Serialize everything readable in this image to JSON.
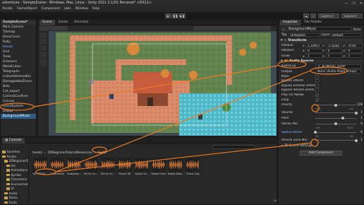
{
  "window": {
    "title": "adventure - SampleScene - Windows, Mac, Linux - Unity 2021.3.12f1 Personal* <DX11>",
    "controls": [
      "—",
      "☐",
      "✕"
    ]
  },
  "menu": [
    "Assets",
    "GameObject",
    "Component",
    "Jobs",
    "Window",
    "Help"
  ],
  "toolbar": {
    "play_icon": "▶",
    "pause_icon": "❚❚",
    "step_icon": "▶❚",
    "cloud_icon": "☁",
    "search_icon": "⌕",
    "layers_label": "Layers",
    "layout_label": "Layout"
  },
  "hierarchy": {
    "scene": "SampleScene*",
    "items": [
      {
        "label": "Main Camera",
        "kind": "normal"
      },
      {
        "label": "Tilemap",
        "kind": "normal"
      },
      {
        "label": "DoenCover",
        "kind": "normal"
      },
      {
        "label": "Ruby",
        "kind": "normal"
      },
      {
        "label": "House",
        "kind": "blue"
      },
      {
        "label": "Grid",
        "kind": "normal"
      },
      {
        "label": "Trees",
        "kind": "normal"
      },
      {
        "label": "Greeners",
        "kind": "normal"
      },
      {
        "label": "MetalCubes",
        "kind": "normal"
      },
      {
        "label": "Telegraphs",
        "kind": "normal"
      },
      {
        "label": "CollectibleHealths",
        "kind": "normal"
      },
      {
        "label": "DamageableZones",
        "kind": "normal"
      },
      {
        "label": "Bots",
        "kind": "normal"
      },
      {
        "label": "Cat_expert",
        "kind": "normal"
      },
      {
        "label": "CameraConfiner",
        "kind": "normal"
      },
      {
        "label": "Canvas",
        "kind": "normal"
      },
      {
        "label": "EventSystem",
        "kind": "normal"
      },
      {
        "label": "Global",
        "kind": "normal"
      },
      {
        "label": "BackgroundMusic",
        "kind": "selected"
      }
    ]
  },
  "scene_view": {
    "tabs": [
      "Scene",
      "Game",
      "Animator"
    ]
  },
  "inspector": {
    "tabs": [
      "Inspector",
      "Tile Palette"
    ],
    "object_name": "BackgroundMusic",
    "static_label": "Static",
    "tag_label": "Tag",
    "tag_value": "Untagged",
    "layer_label": "Layer",
    "layer_value": "Default",
    "transform": {
      "title": "Transform",
      "rows": [
        {
          "label": "Position",
          "x": "1.10957",
          "y": "-1.6282",
          "z": "-0.00"
        },
        {
          "label": "Rotation",
          "x": "0",
          "y": "0",
          "z": "0"
        },
        {
          "label": "Scale",
          "x": "1",
          "y": "1",
          "z": "1"
        }
      ]
    },
    "audio_source": {
      "title": "Audio Source",
      "audioclip_label": "AudioClip",
      "audioclip_value": "♫ 3D MUSIC LOOP",
      "output_label": "Output",
      "output_value": "None (Audio Mixer Group)",
      "toggles": [
        {
          "label": "Mute",
          "checked": false
        },
        {
          "label": "Bypass Effects",
          "checked": false
        },
        {
          "label": "Bypass Listener Effects",
          "checked": false
        },
        {
          "label": "Bypass Reverb Zones",
          "checked": false
        },
        {
          "label": "Play On Awake",
          "checked": true
        },
        {
          "label": "Loop",
          "checked": true
        }
      ],
      "priority_label": "Priority",
      "priority_value": "128",
      "priority_fraction": 0.5,
      "priority_left": "High",
      "priority_right": "Low",
      "volume_label": "Volume",
      "volume_value": "1",
      "volume_fraction": 1.0,
      "pitch_label": "Pitch",
      "pitch_value": "1",
      "pitch_fraction": 0.67,
      "stereo_label": "Stereo Pan",
      "stereo_value": "0",
      "stereo_fraction": 0.5,
      "stereo_left": "Left",
      "stereo_right": "Right",
      "spatial_label": "Spatial Blend",
      "spatial_value": "0",
      "spatial_fraction": 0.0,
      "spatial_left": "2D",
      "spatial_right": "3D",
      "reverb_label": "Reverb Zone Mix",
      "reverb_value": "1",
      "reverb_fraction": 1.0
    },
    "sound_settings": "3D Sound Settings",
    "add_component": "Add Component"
  },
  "console": {
    "tab": "Console"
  },
  "project": {
    "tree": [
      {
        "label": "Favorites",
        "depth": 0
      },
      {
        "label": "Assets",
        "depth": 0
      },
      {
        "label": "2DBeginnerTutorialRes",
        "depth": 1
      },
      {
        "label": "Art",
        "depth": 2
      },
      {
        "label": "Animations",
        "depth": 2
      },
      {
        "label": "Sprites",
        "depth": 2
      },
      {
        "label": "Characters",
        "depth": 2
      },
      {
        "label": "Environment",
        "depth": 2
      },
      {
        "label": "UI",
        "depth": 2
      },
      {
        "label": "Audio",
        "depth": 1
      },
      {
        "label": "Demo",
        "depth": 1
      },
      {
        "label": "Fonts",
        "depth": 1
      },
      {
        "label": "Settings",
        "depth": 1
      }
    ],
    "breadcrumb": [
      "Assets",
      "2DBeginnerTutorialResources",
      "Audio"
    ],
    "assets": [
      {
        "label": "3D MUSIC..."
      },
      {
        "label": "Collectable"
      },
      {
        "label": "Footsteps..."
      },
      {
        "label": "Hit for en..."
      },
      {
        "label": "Hit for en..."
      },
      {
        "label": "Player Hit"
      },
      {
        "label": "Quest Co..."
      },
      {
        "label": "Robot Fixed"
      },
      {
        "label": "Robot Walk..."
      },
      {
        "label": "Throw Cog"
      }
    ],
    "count_badge": "26"
  },
  "colors": {
    "accent_orange": "#f07c24",
    "selection_blue": "#2c5d87",
    "waveform_orange": "#e8803a"
  }
}
